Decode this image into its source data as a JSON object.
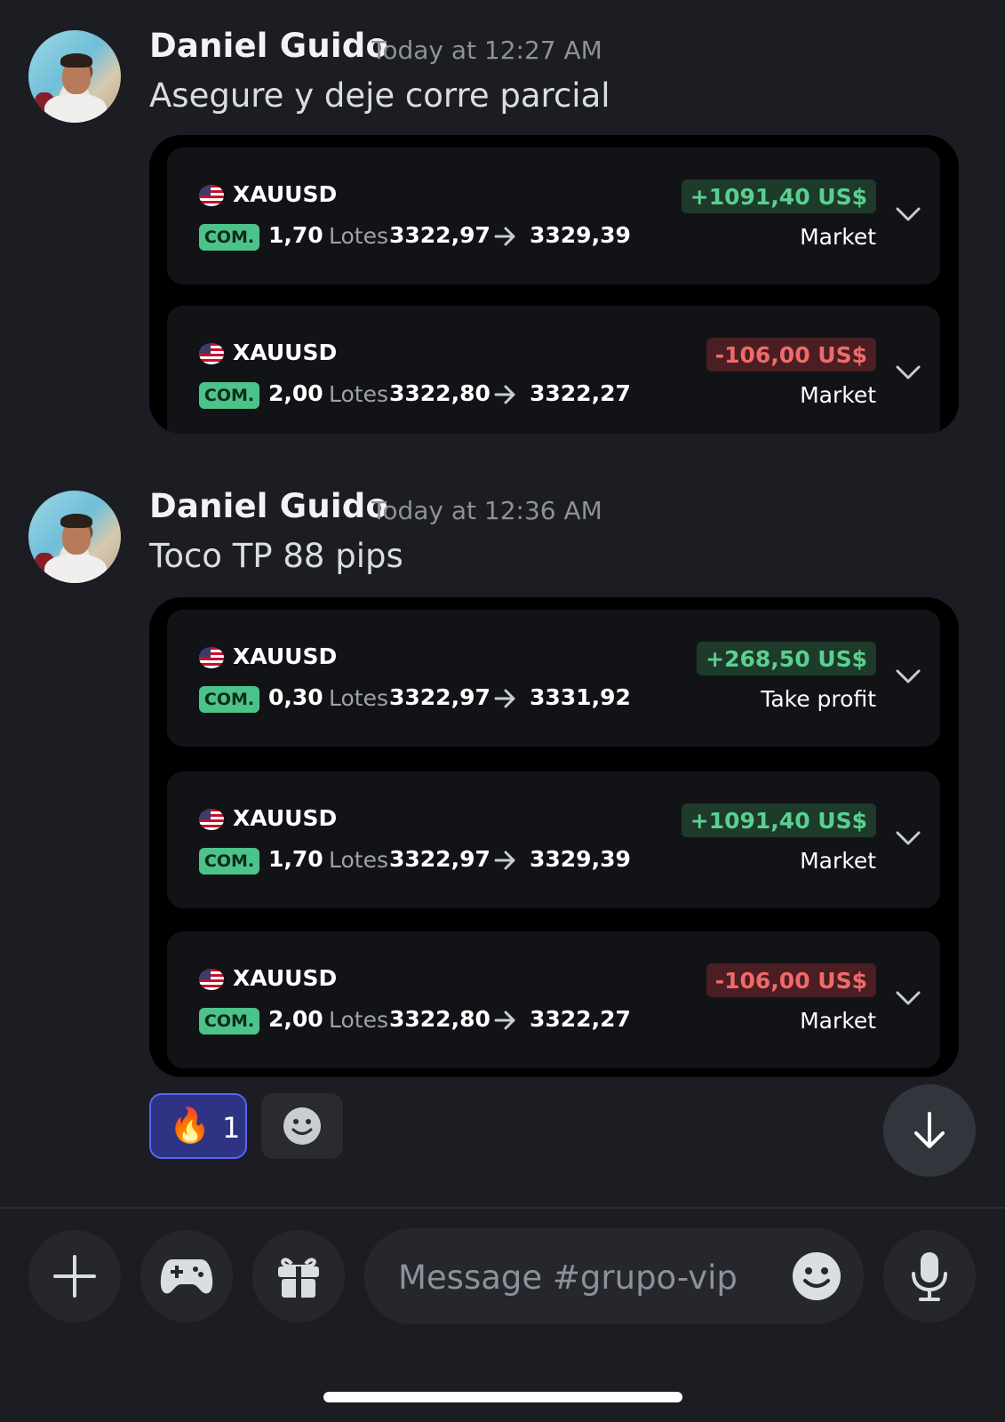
{
  "messages": [
    {
      "author": "Daniel Guido",
      "timestamp": "Today at 12:27 AM",
      "text": "Asegure y deje corre parcial",
      "trades": [
        {
          "symbol": "XAUUSD",
          "side": "COM.",
          "lots": "1,70",
          "lots_label": "Lotes",
          "entry": "3322,97",
          "exit": "3329,39",
          "pnl": "+1091,40 US$",
          "pnl_sign": "positive",
          "close_type": "Market"
        },
        {
          "symbol": "XAUUSD",
          "side": "COM.",
          "lots": "2,00",
          "lots_label": "Lotes",
          "entry": "3322,80",
          "exit": "3322,27",
          "pnl": "-106,00 US$",
          "pnl_sign": "negative",
          "close_type": "Market"
        }
      ]
    },
    {
      "author": "Daniel Guido",
      "timestamp": "Today at 12:36 AM",
      "text": "Toco TP 88 pips",
      "trades": [
        {
          "symbol": "XAUUSD",
          "side": "COM.",
          "lots": "0,30",
          "lots_label": "Lotes",
          "entry": "3322,97",
          "exit": "3331,92",
          "pnl": "+268,50 US$",
          "pnl_sign": "positive",
          "close_type": "Take profit"
        },
        {
          "symbol": "XAUUSD",
          "side": "COM.",
          "lots": "1,70",
          "lots_label": "Lotes",
          "entry": "3322,97",
          "exit": "3329,39",
          "pnl": "+1091,40 US$",
          "pnl_sign": "positive",
          "close_type": "Market"
        },
        {
          "symbol": "XAUUSD",
          "side": "COM.",
          "lots": "2,00",
          "lots_label": "Lotes",
          "entry": "3322,80",
          "exit": "3322,27",
          "pnl": "-106,00 US$",
          "pnl_sign": "negative",
          "close_type": "Market"
        }
      ]
    }
  ],
  "reaction": {
    "emoji": "🔥",
    "count": "1"
  },
  "composer": {
    "placeholder": "Message #grupo-vip"
  },
  "icons": {
    "flag": "us-flag-icon",
    "arrow": "arrow-right-icon",
    "chevron": "chevron-down-icon",
    "add_reaction": "smiley-icon",
    "scroll_down": "arrow-down-icon",
    "plus": "plus-icon",
    "games": "gamepad-icon",
    "gift": "gift-icon",
    "emoji": "smiley-icon",
    "mic": "microphone-icon"
  },
  "colors": {
    "background": "#1c1d22",
    "positive": "#5ad08f",
    "negative": "#f06a6a",
    "badge": "#4cc38a",
    "reaction_accent": "#5865f2"
  }
}
